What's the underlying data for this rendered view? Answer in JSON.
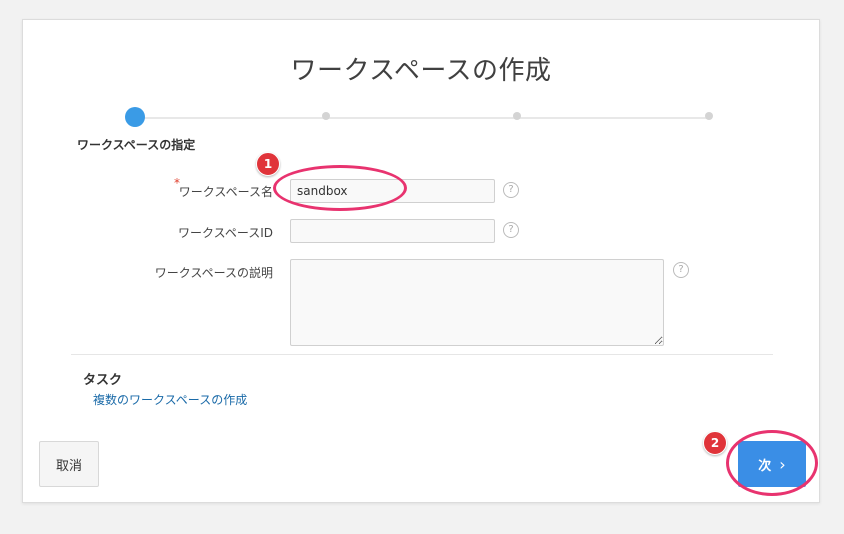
{
  "dialog": {
    "title": "ワークスペースの作成",
    "wizard": {
      "current_step_label": "ワークスペースの指定",
      "step_count": 4,
      "current_step": 1
    },
    "form": {
      "workspace_name": {
        "label": "ワークスペース名",
        "required_mark": "*",
        "value": "sandbox"
      },
      "workspace_id": {
        "label": "ワークスペースID",
        "value": ""
      },
      "workspace_description": {
        "label": "ワークスペースの説明",
        "value": ""
      },
      "help_glyph": "?"
    },
    "tasks": {
      "heading": "タスク",
      "link": "複数のワークスペースの作成"
    },
    "buttons": {
      "cancel": "取消",
      "next": "次",
      "next_chevron": "›"
    }
  },
  "annotations": {
    "badge_1": "1",
    "badge_2": "2"
  },
  "colors": {
    "accent": "#3a8ee6",
    "annotation": "#e8336f",
    "link": "#1a6aa8"
  }
}
